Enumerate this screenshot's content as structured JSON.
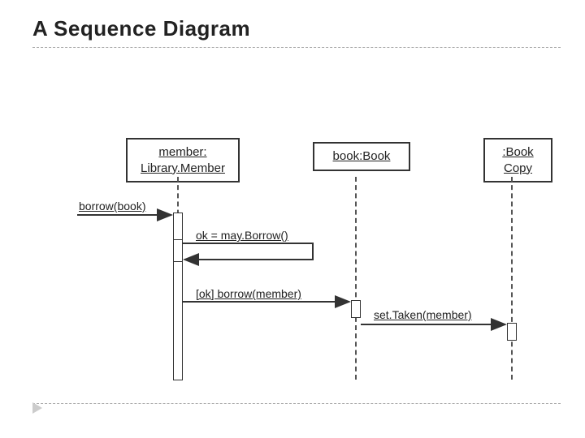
{
  "title": "A Sequence Diagram",
  "lifelines": {
    "member": {
      "label_line1": "member:",
      "label_line2": "Library.Member"
    },
    "book": {
      "label": "book:Book"
    },
    "bookcopy": {
      "label_line1": ":Book",
      "label_line2": "Copy"
    }
  },
  "messages": {
    "borrow_book": "borrow(book)",
    "may_borrow": "ok = may.Borrow()",
    "ok_borrow_member": "[ok] borrow(member)",
    "set_taken": "set.Taken(member)"
  }
}
